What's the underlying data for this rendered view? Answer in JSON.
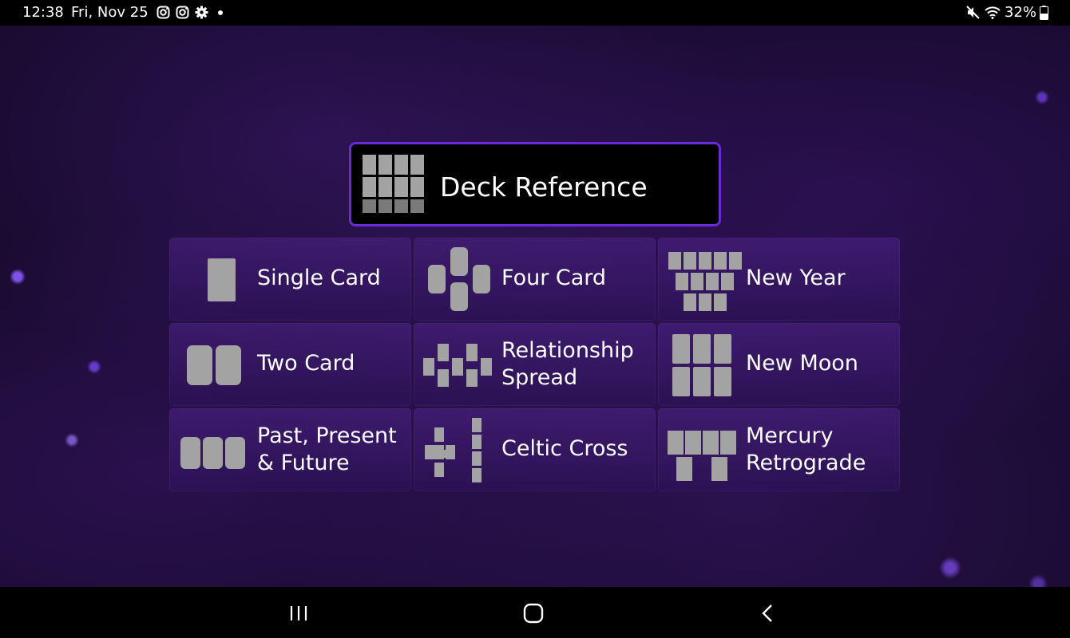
{
  "status_bar": {
    "time": "12:38",
    "date": "Fri, Nov 25",
    "notification_icons": [
      "instagram-icon",
      "instagram-icon",
      "settings-gear-icon",
      "more-dot-icon"
    ],
    "system_icons": [
      "mute-icon",
      "wifi-icon",
      "battery-icon"
    ],
    "battery": "32%"
  },
  "deck_reference": {
    "label": "Deck Reference",
    "icon": "deck-grid-icon"
  },
  "spreads": [
    {
      "label": "Single Card",
      "icon": "single-card-icon"
    },
    {
      "label": "Four Card",
      "icon": "four-card-icon"
    },
    {
      "label": "New Year",
      "icon": "new-year-icon"
    },
    {
      "label": "Two Card",
      "icon": "two-card-icon"
    },
    {
      "label": "Relationship Spread",
      "icon": "relationship-spread-icon"
    },
    {
      "label": "New Moon",
      "icon": "new-moon-icon"
    },
    {
      "label": "Past, Present & Future",
      "icon": "three-card-icon"
    },
    {
      "label": "Celtic Cross",
      "icon": "celtic-cross-icon"
    },
    {
      "label": "Mercury Retrograde",
      "icon": "mercury-retrograde-icon"
    }
  ],
  "nav_bar": {
    "buttons": [
      "recents-icon",
      "home-icon",
      "back-icon"
    ]
  },
  "colors": {
    "accent_border": "#6a2ad8",
    "card_gray": "#a3a3a3",
    "background": "#1c0d33"
  }
}
